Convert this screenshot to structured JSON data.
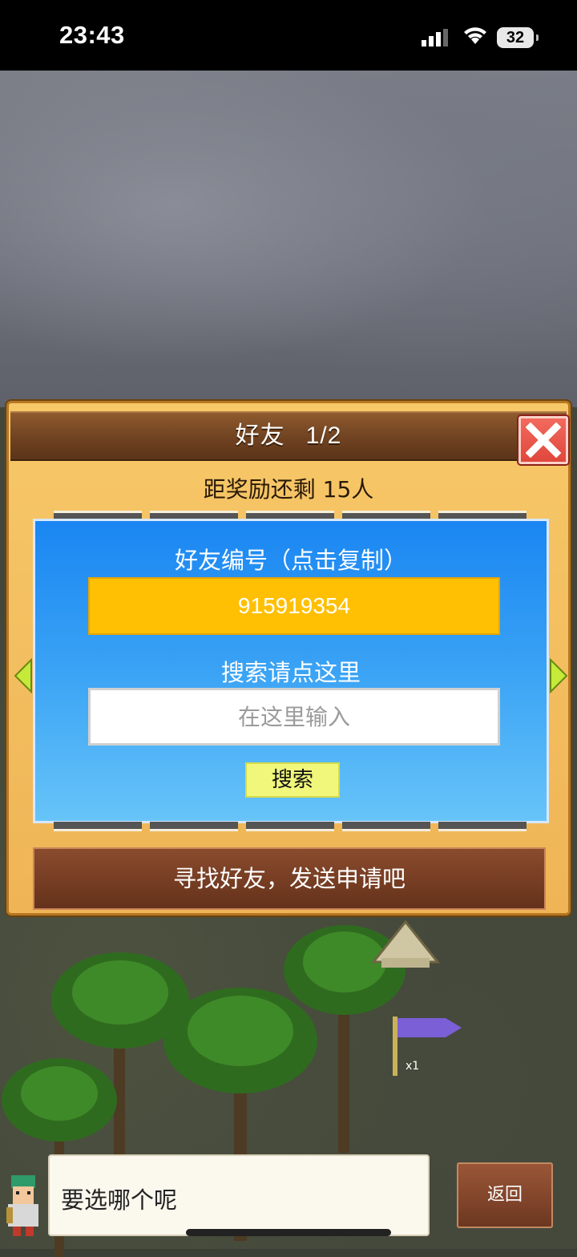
{
  "status_bar": {
    "time": "23:43",
    "battery": "32",
    "icons": [
      "signal-icon",
      "wifi-icon",
      "battery-icon"
    ]
  },
  "dialog": {
    "title": "好友",
    "page": "1/2",
    "reward_text": "距奖励还剩 15人",
    "friend_id_label": "好友编号（点击复制）",
    "friend_id_value": "915919354",
    "search_label": "搜索请点这里",
    "search_placeholder": "在这里输入",
    "search_button": "搜索",
    "find_friends_text": "寻找好友，发送申请吧"
  },
  "footer": {
    "speech_text": "要选哪个呢",
    "back_button": "返回"
  },
  "colors": {
    "panel_blue": "#1a86f2",
    "friend_id_yellow": "#ffc003",
    "search_button_yellow": "#f0f77a",
    "dialog_orange": "#f7c868",
    "header_brown": "#6f4221",
    "close_red": "#e0473c"
  }
}
